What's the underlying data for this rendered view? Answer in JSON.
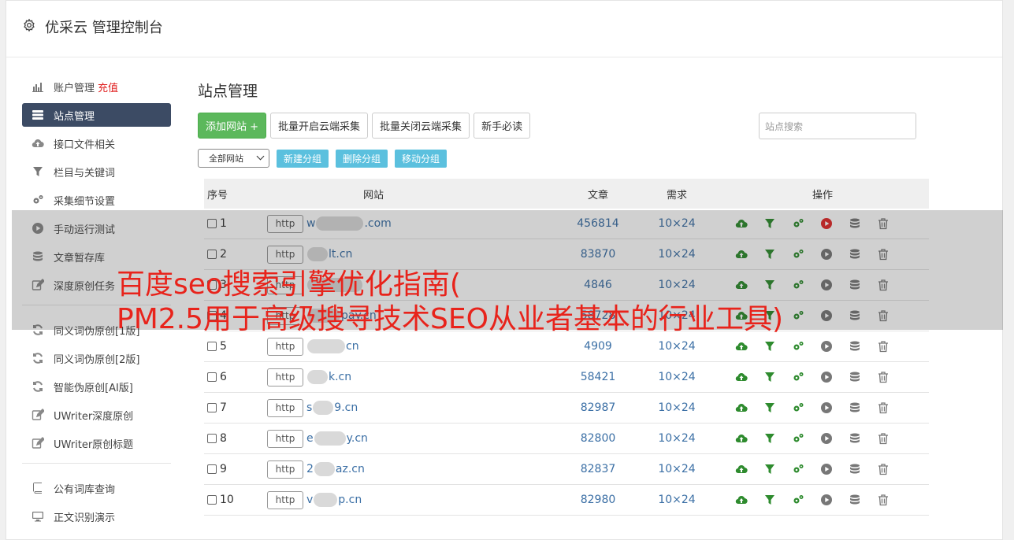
{
  "header": {
    "title": "优采云 管理控制台"
  },
  "sidebar": {
    "items": [
      {
        "label": "账户管理",
        "extra": "充值",
        "icon": "bar-chart-icon"
      },
      {
        "label": "站点管理",
        "icon": "server-list-icon",
        "active": true
      },
      {
        "label": "接口文件相关",
        "icon": "cloud-upload-icon"
      },
      {
        "label": "栏目与关键词",
        "icon": "filter-icon"
      },
      {
        "label": "采集细节设置",
        "icon": "gears-icon"
      },
      {
        "label": "手动运行测试",
        "icon": "play-circle-icon"
      },
      {
        "label": "文章暂存库",
        "icon": "database-icon"
      },
      {
        "label": "深度原创任务",
        "icon": "edit-icon"
      }
    ],
    "items2": [
      {
        "label": "同义词伪原创[1版]",
        "icon": "refresh-icon"
      },
      {
        "label": "同义词伪原创[2版]",
        "icon": "refresh-icon"
      },
      {
        "label": "智能伪原创[AI版]",
        "icon": "refresh-icon"
      },
      {
        "label": "UWriter深度原创",
        "icon": "edit-icon"
      },
      {
        "label": "UWriter原创标题",
        "icon": "edit-icon"
      }
    ],
    "items3": [
      {
        "label": "公有词库查询",
        "icon": "book-icon"
      },
      {
        "label": "正文识别演示",
        "icon": "monitor-icon"
      }
    ]
  },
  "main": {
    "title": "站点管理",
    "buttons": {
      "add": "添加网站 +",
      "batch_open": "批量开启云端采集",
      "batch_close": "批量关闭云端采集",
      "guide": "新手必读"
    },
    "search_placeholder": "站点搜索",
    "group_select": "全部网站",
    "group_buttons": {
      "new": "新建分组",
      "delete": "删除分组",
      "move": "移动分组"
    }
  },
  "table": {
    "headers": {
      "no": "序号",
      "site": "网站",
      "articles": "文章",
      "demand": "需求",
      "ops": "操作"
    },
    "rows": [
      {
        "no": "1",
        "prefix": "w",
        "suffix": ".com",
        "articles": "456814",
        "demand": "10×24",
        "play_active": true
      },
      {
        "no": "2",
        "prefix": "",
        "suffix": "lt.cn",
        "articles": "83870",
        "demand": "10×24",
        "play_active": false
      },
      {
        "no": "3",
        "prefix": "",
        "suffix": "",
        "articles": "4846",
        "demand": "10×24",
        "play_active": false
      },
      {
        "no": "4",
        "prefix": "",
        "suffix": "pay.cn",
        "articles": "58728",
        "demand": "10×24",
        "play_active": false
      },
      {
        "no": "5",
        "prefix": "",
        "suffix": "cn",
        "articles": "4909",
        "demand": "10×24",
        "play_active": false
      },
      {
        "no": "6",
        "prefix": "",
        "suffix": "k.cn",
        "articles": "58421",
        "demand": "10×24",
        "play_active": false
      },
      {
        "no": "7",
        "prefix": "s",
        "suffix": "9.cn",
        "articles": "82987",
        "demand": "10×24",
        "play_active": false
      },
      {
        "no": "8",
        "prefix": "e",
        "suffix": "y.cn",
        "articles": "82800",
        "demand": "10×24",
        "play_active": false
      },
      {
        "no": "9",
        "prefix": "2",
        "suffix": "az.cn",
        "articles": "82837",
        "demand": "10×24",
        "play_active": false
      },
      {
        "no": "10",
        "prefix": "v",
        "suffix": "p.cn",
        "articles": "82980",
        "demand": "10×24",
        "play_active": false
      }
    ],
    "http_label": "http"
  },
  "overlay": {
    "line1": "百度seo搜索引擎优化指南(",
    "line2": "PM2.5用于高级搜寻技术SEO从业者基本的行业工具)"
  },
  "colors": {
    "active_nav": "#3c4b64",
    "green_button": "#5cb85c",
    "info_button": "#5bc0de",
    "link": "#3b6fa5",
    "overlay_text": "#e8231b",
    "recharge": "#e02020"
  }
}
